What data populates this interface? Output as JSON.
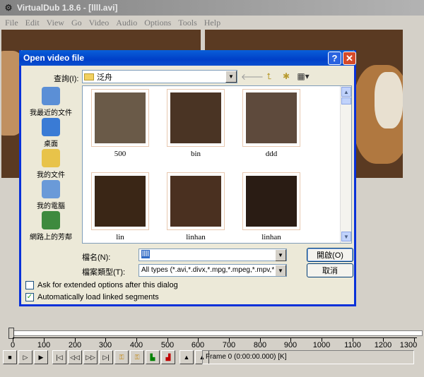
{
  "app": {
    "title": "VirtualDub 1.8.6 - [llll.avi]",
    "menu": [
      "File",
      "Edit",
      "View",
      "Go",
      "Video",
      "Audio",
      "Options",
      "Tools",
      "Help"
    ]
  },
  "dialog": {
    "title": "Open video file",
    "help_glyph": "?",
    "close_glyph": "✕",
    "lookin_label": "查詢(I):",
    "lookin_value": "泛舟",
    "places": [
      {
        "label": "我最近的文件",
        "color": "#5b8fd6"
      },
      {
        "label": "桌面",
        "color": "#3a7bd5"
      },
      {
        "label": "我的文件",
        "color": "#e8c34a"
      },
      {
        "label": "我的電腦",
        "color": "#6a9ad8"
      },
      {
        "label": "網路上的芳鄰",
        "color": "#3e8a3e"
      }
    ],
    "files": [
      {
        "name": "500",
        "color": "#6a5a48"
      },
      {
        "name": "bin",
        "color": "#4a3424"
      },
      {
        "name": "ddd",
        "color": "#5e4a3c"
      },
      {
        "name": "lin",
        "color": "#3a2616"
      },
      {
        "name": "linhan",
        "color": "#4a3020"
      },
      {
        "name": "linhan",
        "color": "#2a1c14"
      }
    ],
    "filename_label": "檔名(N):",
    "filename_value": "llll",
    "filetype_label": "檔案類型(T):",
    "filetype_value": "All types (*.avi,*.divx,*.mpg,*.mpeg,*.mpv,*.m",
    "open_label": "開啟(O)",
    "cancel_label": "取消",
    "option_extended": "Ask for extended options after this dialog",
    "option_extended_checked": false,
    "option_linked": "Automatically load linked segments",
    "option_linked_checked": true
  },
  "timeline": {
    "ticks": [
      "0",
      "100",
      "200",
      "300",
      "400",
      "500",
      "600",
      "700",
      "800",
      "900",
      "1000",
      "1100",
      "1200",
      "1300"
    ],
    "frame_info": "Frame 0 (0:00:00.000) [K]"
  },
  "icons": {
    "back": "back-arrow-icon",
    "up": "up-folder-icon",
    "newfolder": "new-folder-icon",
    "views": "views-menu-icon"
  }
}
